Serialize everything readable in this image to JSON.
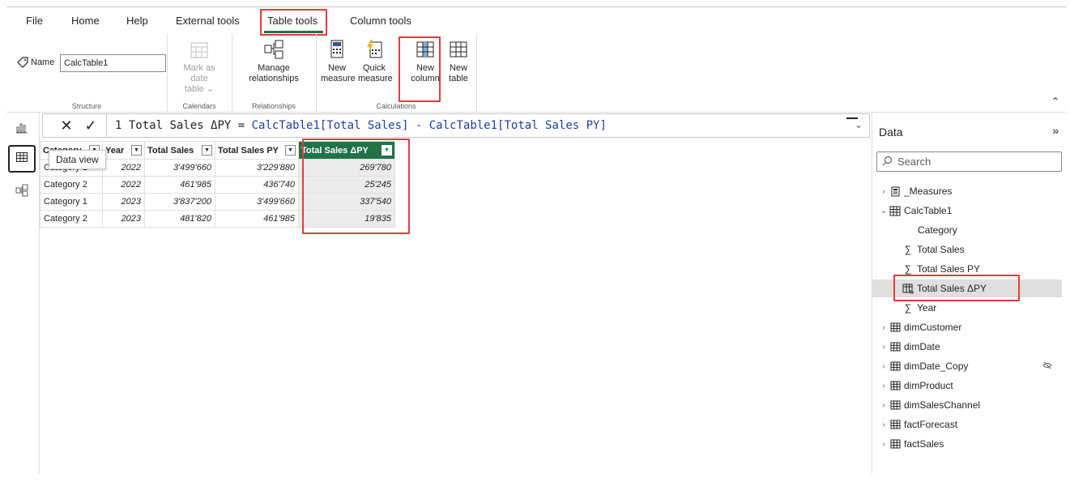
{
  "menu": {
    "items": [
      "File",
      "Home",
      "Help",
      "External tools",
      "Table tools",
      "Column tools"
    ],
    "active": "Table tools"
  },
  "ribbon": {
    "structure": {
      "name_label": "Name",
      "name_value": "CalcTable1",
      "group_label": "Structure"
    },
    "calendars": {
      "mark_date_line1": "Mark as date",
      "mark_date_line2": "table",
      "group_label": "Calendars"
    },
    "relationships": {
      "manage_line1": "Manage",
      "manage_line2": "relationships",
      "group_label": "Relationships"
    },
    "calculations": {
      "new_measure_line1": "New",
      "new_measure_line2": "measure",
      "quick_measure_line1": "Quick",
      "quick_measure_line2": "measure",
      "new_column_line1": "New",
      "new_column_line2": "column",
      "new_table_line1": "New",
      "new_table_line2": "table",
      "group_label": "Calculations"
    }
  },
  "left_rail": {
    "tooltip": "Data view"
  },
  "formula_bar": {
    "line_number": "1",
    "prefix": " Total Sales ΔPY = ",
    "expression": "CalcTable1[Total Sales] - CalcTable1[Total Sales PY]"
  },
  "table": {
    "columns": [
      "Category",
      "Year",
      "Total Sales",
      "Total Sales PY",
      "Total Sales ΔPY"
    ],
    "rows": [
      [
        "Category 1",
        "2022",
        "3'499'660",
        "3'229'880",
        "269'780"
      ],
      [
        "Category 2",
        "2022",
        "461'985",
        "436'740",
        "25'245"
      ],
      [
        "Category 1",
        "2023",
        "3'837'200",
        "3'499'660",
        "337'540"
      ],
      [
        "Category 2",
        "2023",
        "481'820",
        "461'985",
        "19'835"
      ]
    ]
  },
  "data_pane": {
    "title": "Data",
    "search_placeholder": "Search",
    "tables": [
      {
        "name": "_Measures",
        "expanded": false,
        "icon": "measure-table-icon"
      },
      {
        "name": "CalcTable1",
        "expanded": true,
        "icon": "calc-table-icon",
        "fields": [
          {
            "name": "Category",
            "icon": "none"
          },
          {
            "name": "Total Sales",
            "icon": "sigma-icon"
          },
          {
            "name": "Total Sales PY",
            "icon": "sigma-icon"
          },
          {
            "name": "Total Sales ΔPY",
            "icon": "calc-column-icon",
            "selected": true
          },
          {
            "name": "Year",
            "icon": "sigma-icon"
          }
        ]
      },
      {
        "name": "dimCustomer",
        "expanded": false,
        "icon": "table-icon"
      },
      {
        "name": "dimDate",
        "expanded": false,
        "icon": "table-icon"
      },
      {
        "name": "dimDate_Copy",
        "expanded": false,
        "icon": "table-icon",
        "hidden": true
      },
      {
        "name": "dimProduct",
        "expanded": false,
        "icon": "table-icon"
      },
      {
        "name": "dimSalesChannel",
        "expanded": false,
        "icon": "table-icon"
      },
      {
        "name": "factForecast",
        "expanded": false,
        "icon": "table-icon"
      },
      {
        "name": "factSales",
        "expanded": false,
        "icon": "table-icon"
      }
    ]
  },
  "colors": {
    "accent": "#217346",
    "highlight": "#e03c3c"
  }
}
